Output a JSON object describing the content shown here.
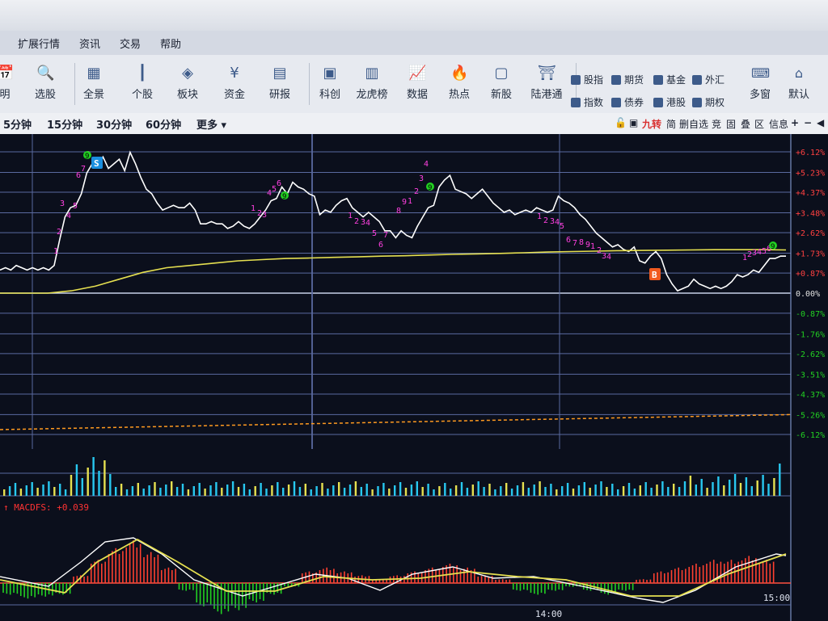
{
  "menu": [
    "扩展行情",
    "资讯",
    "交易",
    "帮助"
  ],
  "toolbar": {
    "main": [
      {
        "label": "明",
        "icon": "calendar-icon"
      },
      {
        "label": "选股",
        "icon": "magnify-chart-icon"
      },
      {
        "label": "全景",
        "icon": "grid-icon"
      },
      {
        "label": "个股",
        "icon": "candlestick-icon"
      },
      {
        "label": "板块",
        "icon": "layers-icon"
      },
      {
        "label": "资金",
        "icon": "yen-coin-icon"
      },
      {
        "label": "研报",
        "icon": "report-icon"
      },
      {
        "label": "科创",
        "icon": "chip-icon"
      },
      {
        "label": "龙虎榜",
        "icon": "bar-rank-icon"
      },
      {
        "label": "数据",
        "icon": "line-chart-icon"
      },
      {
        "label": "热点",
        "icon": "flame-icon"
      },
      {
        "label": "新股",
        "icon": "ipo-icon"
      },
      {
        "label": "陆港通",
        "icon": "bridge-icon"
      }
    ],
    "quick_top": [
      "股指",
      "期货",
      "基金",
      "外汇"
    ],
    "quick_bottom": [
      "指数",
      "债券",
      "港股",
      "期权"
    ],
    "multi_window": "多窗",
    "default": "默认"
  },
  "periods": [
    "5分钟",
    "15分钟",
    "30分钟",
    "60分钟"
  ],
  "more": "更多",
  "right_tools": [
    "简",
    "删自选",
    "竞",
    "固",
    "叠",
    "区",
    "信息",
    "+",
    "−"
  ],
  "jiuzhuan": "九转",
  "colors": {
    "up": "#ff3333",
    "down": "#22cc22",
    "price": "#ffffff",
    "avg": "#e6e050",
    "axis": "#7c8fc4"
  },
  "chart_data": {
    "type": "line",
    "pct_axis": [
      "+6.12%",
      "+5.23%",
      "+4.37%",
      "+3.48%",
      "+2.62%",
      "+1.73%",
      "+0.87%",
      "0.00%",
      "-0.87%",
      "-1.76%",
      "-2.62%",
      "-3.51%",
      "-4.37%",
      "-5.26%",
      "-6.12%"
    ],
    "price_pct": [
      1.0,
      1.1,
      1.0,
      1.2,
      1.1,
      1.0,
      1.1,
      1.0,
      1.1,
      1.0,
      1.2,
      2.3,
      3.3,
      3.7,
      3.8,
      4.3,
      5.2,
      5.6,
      5.5,
      5.9,
      5.4,
      5.6,
      5.8,
      5.3,
      6.1,
      5.6,
      5.0,
      4.5,
      4.3,
      3.9,
      3.6,
      3.7,
      3.8,
      3.7,
      3.7,
      3.9,
      3.6,
      3.0,
      3.0,
      3.1,
      3.0,
      3.0,
      2.8,
      2.9,
      3.1,
      2.9,
      2.8,
      3.0,
      3.3,
      3.6,
      4.0,
      4.1,
      4.6,
      4.3,
      4.8,
      4.6,
      4.5,
      4.3,
      4.2,
      3.4,
      3.6,
      3.5,
      3.8,
      4.0,
      4.1,
      3.7,
      3.5,
      3.3,
      3.5,
      3.3,
      3.1,
      2.7,
      2.7,
      2.4,
      2.7,
      2.5,
      2.4,
      2.9,
      3.3,
      3.7,
      3.8,
      4.6,
      4.9,
      5.1,
      4.5,
      4.4,
      4.3,
      4.1,
      4.3,
      4.5,
      4.2,
      3.9,
      3.7,
      3.5,
      3.6,
      3.4,
      3.5,
      3.6,
      3.5,
      3.7,
      3.6,
      3.5,
      3.6,
      4.2,
      4.0,
      3.9,
      3.7,
      3.4,
      3.2,
      2.9,
      2.6,
      2.4,
      2.2,
      2.0,
      2.1,
      1.9,
      1.8,
      2.0,
      1.4,
      1.3,
      1.6,
      1.8,
      1.5,
      0.8,
      0.4,
      0.1,
      0.2,
      0.3,
      0.6,
      0.4,
      0.3,
      0.2,
      0.3,
      0.2,
      0.3,
      0.5,
      0.8,
      0.7,
      0.8,
      1.0,
      0.9,
      1.2,
      1.5,
      1.5,
      1.6,
      1.6
    ],
    "avg_pct": [
      0.0,
      0.0,
      0.0,
      0.1,
      0.3,
      0.6,
      0.9,
      1.1,
      1.2,
      1.3,
      1.4,
      1.45,
      1.5,
      1.52,
      1.55,
      1.57,
      1.6,
      1.62,
      1.65,
      1.68,
      1.7,
      1.72,
      1.75,
      1.78,
      1.8,
      1.82,
      1.84,
      1.85,
      1.86,
      1.87,
      1.88,
      1.88,
      1.88,
      1.87
    ],
    "time_labels": [
      "14:00",
      "15:00"
    ],
    "macd_label": "MACDFS: +0.039",
    "macd_hist": [
      -0.3,
      -0.4,
      -0.35,
      -0.3,
      0.2,
      0.6,
      0.9,
      1.1,
      0.8,
      0.4,
      -0.2,
      -0.6,
      -0.8,
      -0.7,
      -0.5,
      -0.3,
      -0.1,
      0.3,
      0.4,
      0.3,
      0.2,
      0.1,
      0.2,
      0.3,
      0.4,
      0.5,
      0.4,
      0.2,
      0.1,
      -0.2,
      -0.3,
      -0.2,
      -0.1,
      -0.2,
      -0.3,
      -0.2,
      0.1,
      0.3,
      0.4,
      0.5,
      0.6,
      0.6,
      0.7,
      0.6
    ]
  },
  "signals": {
    "buy": "B",
    "sell": "S",
    "seq_top": [
      "1",
      "2",
      "3",
      "4",
      "5",
      "6",
      "7",
      "8",
      "9"
    ]
  }
}
